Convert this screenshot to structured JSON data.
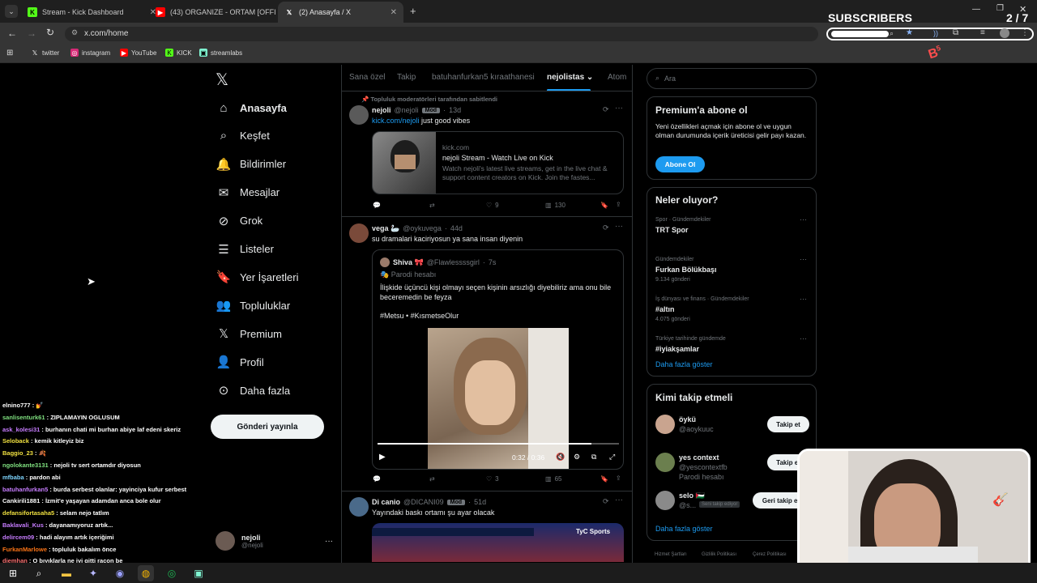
{
  "browser": {
    "tabs": [
      {
        "title": "Stream - Kick Dashboard",
        "icon": "kick-icon"
      },
      {
        "title": "(43) ORGANIZE - ORTAM [OFFI",
        "icon": "youtube-icon"
      },
      {
        "title": "(2) Anasayfa / X",
        "icon": "x-icon"
      }
    ],
    "url": "x.com/home",
    "bookmarks": [
      "twitter",
      "instagram",
      "YouTube",
      "KICK",
      "streamlabs"
    ]
  },
  "overlay": {
    "subscribers_label": "SUBSCRIBERS",
    "subscribers_count": "2 / 7",
    "progress": 0.29
  },
  "nav": {
    "items": [
      {
        "label": "Anasayfa",
        "icon": "home-icon",
        "bold": true
      },
      {
        "label": "Keşfet",
        "icon": "search-icon"
      },
      {
        "label": "Bildirimler",
        "icon": "bell-icon"
      },
      {
        "label": "Mesajlar",
        "icon": "mail-icon"
      },
      {
        "label": "Grok",
        "icon": "grok-icon"
      },
      {
        "label": "Listeler",
        "icon": "list-icon"
      },
      {
        "label": "Yer İşaretleri",
        "icon": "bookmark-icon"
      },
      {
        "label": "Topluluklar",
        "icon": "communities-icon"
      },
      {
        "label": "Premium",
        "icon": "x-premium-icon"
      },
      {
        "label": "Profil",
        "icon": "profile-icon"
      },
      {
        "label": "Daha fazla",
        "icon": "more-circle-icon"
      }
    ],
    "post_button": "Gönderi yayınla",
    "account": {
      "name": "nejoli",
      "handle": "@nejoli"
    }
  },
  "feed": {
    "tabs": [
      "Sana özel",
      "Takip",
      "batuhanfurkan5 kıraathanesi",
      "nejolistas",
      "Atom"
    ],
    "active_tab": "nejolistas",
    "pinned_label": "Topluluk moderatörleri tarafından sabitlendi",
    "posts": [
      {
        "name": "nejoli",
        "handle": "@nejoli",
        "badge": "Mod",
        "time": "13d",
        "link": "kick.com/nejoli",
        "text": " just good vibes",
        "card": {
          "domain": "kick.com",
          "title": "nejoli Stream - Watch Live on Kick",
          "desc": "Watch nejoli's latest live streams, get in the live chat & support content creators on Kick. Join the fastes..."
        },
        "stats": {
          "likes": "9",
          "views": "130"
        }
      },
      {
        "name": "vega 🦢",
        "handle": "@oykuvega",
        "time": "44d",
        "text": "su dramalari kaciriyosun ya sana insan diyenin",
        "quote": {
          "name": "Shiva 🎀",
          "handle": "@Flawlessssgirl",
          "time": "7s",
          "label": "Parodi hesabı",
          "text": "İlişkide üçüncü kişi olmayı seçen kişinin arsızlığı diyebiliriz ama onu bile beceremedin be feyza",
          "tags": "#Metsu • #KısmetseOlur"
        },
        "video_time": "0:32 / 0:36",
        "stats": {
          "likes": "3",
          "views": "65"
        }
      },
      {
        "name": "Di canio",
        "handle": "@DICANI09",
        "badge": "Mod",
        "time": "51d",
        "text": "Yayındaki baskı ortamı şu ayar olacak",
        "media_label": "TyC Sports"
      }
    ]
  },
  "search": {
    "placeholder": "Ara"
  },
  "premium": {
    "title": "Premium'a abone ol",
    "text": "Yeni özellikleri açmak için abone ol ve uygun olman durumunda içerik üreticisi gelir payı kazan.",
    "button": "Abone Ol"
  },
  "trends": {
    "title": "Neler oluyor?",
    "items": [
      {
        "category": "Spor · Gündemdekiler",
        "name": "TRT Spor",
        "count": ""
      },
      {
        "category": "Gündemdekiler",
        "name": "Furkan Bölükbaşı",
        "count": "9.134 gönderi"
      },
      {
        "category": "İş dünyası ve finans · Gündemdekiler",
        "name": "#altın",
        "count": "4.075 gönderi"
      },
      {
        "category": "Türkiye tarihinde gündemde",
        "name": "#iyiakşamlar",
        "count": ""
      }
    ],
    "show_more": "Daha fazla göster"
  },
  "who_to_follow": {
    "title": "Kimi takip etmeli",
    "items": [
      {
        "name": "öykü",
        "handle": "@aoykuuc",
        "button": "Takip et",
        "extra": ""
      },
      {
        "name": "yes context",
        "handle": "@yescontextfb",
        "button": "Takip et",
        "extra": "Parodi hesabı"
      },
      {
        "name": "selo 🇵🇸",
        "handle": "@s...",
        "button": "Geri takip et",
        "extra": "Seni takip ediyor"
      }
    ],
    "show_more": "Daha fazla göster"
  },
  "footer": [
    "Hizmet Şartları",
    "Gizlilik Politikası",
    "Çerez Politikası"
  ],
  "chat": [
    {
      "user": "elnino777",
      "msg": " : 💅",
      "color": "#ffffff"
    },
    {
      "user": "sanlisenturk61",
      "msg": " : ZIPLAMAYIN OGLUSUM",
      "color": "#7fe07f"
    },
    {
      "user": "ask_kolesi31",
      "msg": " : burhanın chati mi burhan abiye laf edeni skeriz",
      "color": "#c77dff"
    },
    {
      "user": "Seloback",
      "msg": " : kemik kitleyiz biz",
      "color": "#f0e040"
    },
    {
      "user": "Baggio_23",
      "msg": " : 🍂",
      "color": "#f0e040"
    },
    {
      "user": "ngolokante3131",
      "msg": " : nejoli tv sert ortamdır diyosun",
      "color": "#7fe07f"
    },
    {
      "user": "mfbaba",
      "msg": " : pardon abi",
      "color": "#7dd3fc"
    },
    {
      "user": "batuhanfurkan5",
      "msg": " : burda serbest olanlar: yayinciya kufur serbest",
      "color": "#c77dff"
    },
    {
      "user": "Cankirili1881",
      "msg": " : İzmit'e yaşayan adamdan anca bole olur",
      "color": "#ffffff"
    },
    {
      "user": "defansifortasaha5",
      "msg": " : selam nejo tatlım",
      "color": "#f0e040"
    },
    {
      "user": "Baklavali_Kus",
      "msg": " : dayanamıyoruz artık...",
      "color": "#c77dff"
    },
    {
      "user": "delircem09",
      "msg": " : hadi alayım artık içeriğimi",
      "color": "#c77dff"
    },
    {
      "user": "FurkanMarlowe",
      "msg": " : topluluk bakalım önce",
      "color": "#f97316"
    },
    {
      "user": "djemhan",
      "msg": " : O bıyıklarla ne iyi gitti racon be",
      "color": "#f87171"
    }
  ],
  "colors": {
    "accent": "#1d9bf0",
    "bg": "#000000",
    "border": "#2f3336",
    "muted": "#71767b"
  }
}
